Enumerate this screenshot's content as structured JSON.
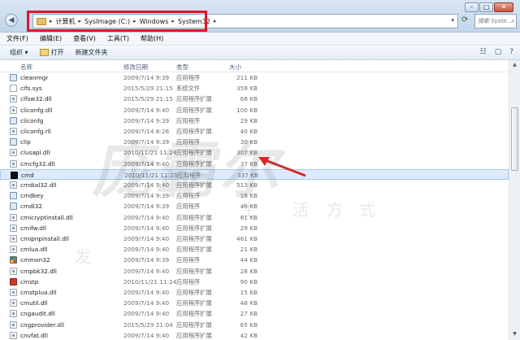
{
  "window": {
    "controls": [
      "–",
      "□",
      "✕"
    ]
  },
  "address": {
    "crumbs": [
      "计算机",
      "SysImage (C:)",
      "Windows",
      "System32"
    ],
    "search_placeholder": "搜索 Syste..."
  },
  "menu": [
    "文件(F)",
    "编辑(E)",
    "查看(V)",
    "工具(T)",
    "帮助(H)"
  ],
  "toolbar": {
    "organize": "组织 ▾",
    "open": "打开",
    "new_folder": "新建文件夹"
  },
  "columns": {
    "name": "名称",
    "date": "修改日期",
    "type": "类型",
    "size": "大小"
  },
  "files": [
    {
      "name": "cleanmgr",
      "date": "2009/7/14 9:39",
      "type": "应用程序",
      "size": "211 KB",
      "icon": "exe"
    },
    {
      "name": "clfs.sys",
      "date": "2015/5/29 21:15",
      "type": "系统文件",
      "size": "359 KB",
      "icon": "sys"
    },
    {
      "name": "clfsw32.dll",
      "date": "2015/5/29 21:15",
      "type": "应用程序扩展",
      "size": "68 KB",
      "icon": "dll"
    },
    {
      "name": "cliconfg.dll",
      "date": "2009/7/14 9:40",
      "type": "应用程序扩展",
      "size": "100 KB",
      "icon": "dll"
    },
    {
      "name": "cliconfg",
      "date": "2009/7/14 9:39",
      "type": "应用程序",
      "size": "29 KB",
      "icon": "exe"
    },
    {
      "name": "cliconfg.rll",
      "date": "2009/7/14 8:28",
      "type": "应用程序扩展",
      "size": "40 KB",
      "icon": "dll"
    },
    {
      "name": "clip",
      "date": "2009/7/14 9:39",
      "type": "应用程序",
      "size": "30 KB",
      "icon": "exe"
    },
    {
      "name": "clusapi.dll",
      "date": "2010/11/21 11:24",
      "type": "应用程序扩展",
      "size": "307 KB",
      "icon": "dll"
    },
    {
      "name": "cmcfg32.dll",
      "date": "2009/7/14 9:40",
      "type": "应用程序扩展",
      "size": "37 KB",
      "icon": "dll"
    },
    {
      "name": "cmd",
      "date": "2010/11/21 11:23",
      "type": "应用程序",
      "size": "337 KB",
      "icon": "cmd",
      "selected": true
    },
    {
      "name": "cmdial32.dll",
      "date": "2009/7/14 9:40",
      "type": "应用程序扩展",
      "size": "513 KB",
      "icon": "dll"
    },
    {
      "name": "cmdkey",
      "date": "2009/7/14 9:39",
      "type": "应用程序",
      "size": "16 KB",
      "icon": "exe"
    },
    {
      "name": "cmdl32",
      "date": "2009/7/14 9:39",
      "type": "应用程序",
      "size": "46 KB",
      "icon": "exe"
    },
    {
      "name": "cmicryptinstall.dll",
      "date": "2009/7/14 9:40",
      "type": "应用程序扩展",
      "size": "81 KB",
      "icon": "dll"
    },
    {
      "name": "cmifw.dll",
      "date": "2009/7/14 9:40",
      "type": "应用程序扩展",
      "size": "29 KB",
      "icon": "dll"
    },
    {
      "name": "cmipnpinstall.dll",
      "date": "2009/7/14 9:40",
      "type": "应用程序扩展",
      "size": "461 KB",
      "icon": "dll"
    },
    {
      "name": "cmlua.dll",
      "date": "2009/7/14 9:40",
      "type": "应用程序扩展",
      "size": "21 KB",
      "icon": "dll"
    },
    {
      "name": "cmmon32",
      "date": "2009/7/14 9:39",
      "type": "应用程序",
      "size": "44 KB",
      "icon": "mon"
    },
    {
      "name": "cmpbk32.dll",
      "date": "2009/7/14 9:40",
      "type": "应用程序扩展",
      "size": "28 KB",
      "icon": "dll"
    },
    {
      "name": "cmstp",
      "date": "2010/11/21 11:24",
      "type": "应用程序",
      "size": "90 KB",
      "icon": "stp"
    },
    {
      "name": "cmstplua.dll",
      "date": "2009/7/14 9:40",
      "type": "应用程序扩展",
      "size": "15 KB",
      "icon": "dll"
    },
    {
      "name": "cmutil.dll",
      "date": "2009/7/14 9:40",
      "type": "应用程序扩展",
      "size": "48 KB",
      "icon": "dll"
    },
    {
      "name": "cngaudit.dll",
      "date": "2009/7/14 9:40",
      "type": "应用程序扩展",
      "size": "27 KB",
      "icon": "dll"
    },
    {
      "name": "cngprovider.dll",
      "date": "2015/5/29 21:04",
      "type": "应用程序扩展",
      "size": "65 KB",
      "icon": "dll"
    },
    {
      "name": "cnvfat.dll",
      "date": "2009/7/14 9:40",
      "type": "应用程序扩展",
      "size": "42 KB",
      "icon": "dll"
    }
  ],
  "colors": {
    "highlight": "#e0162b",
    "selection": "#dcebfb"
  },
  "watermark": {
    "big": "庞霸尔",
    "small": [
      "发",
      "生",
      "活",
      "方",
      "式"
    ]
  }
}
